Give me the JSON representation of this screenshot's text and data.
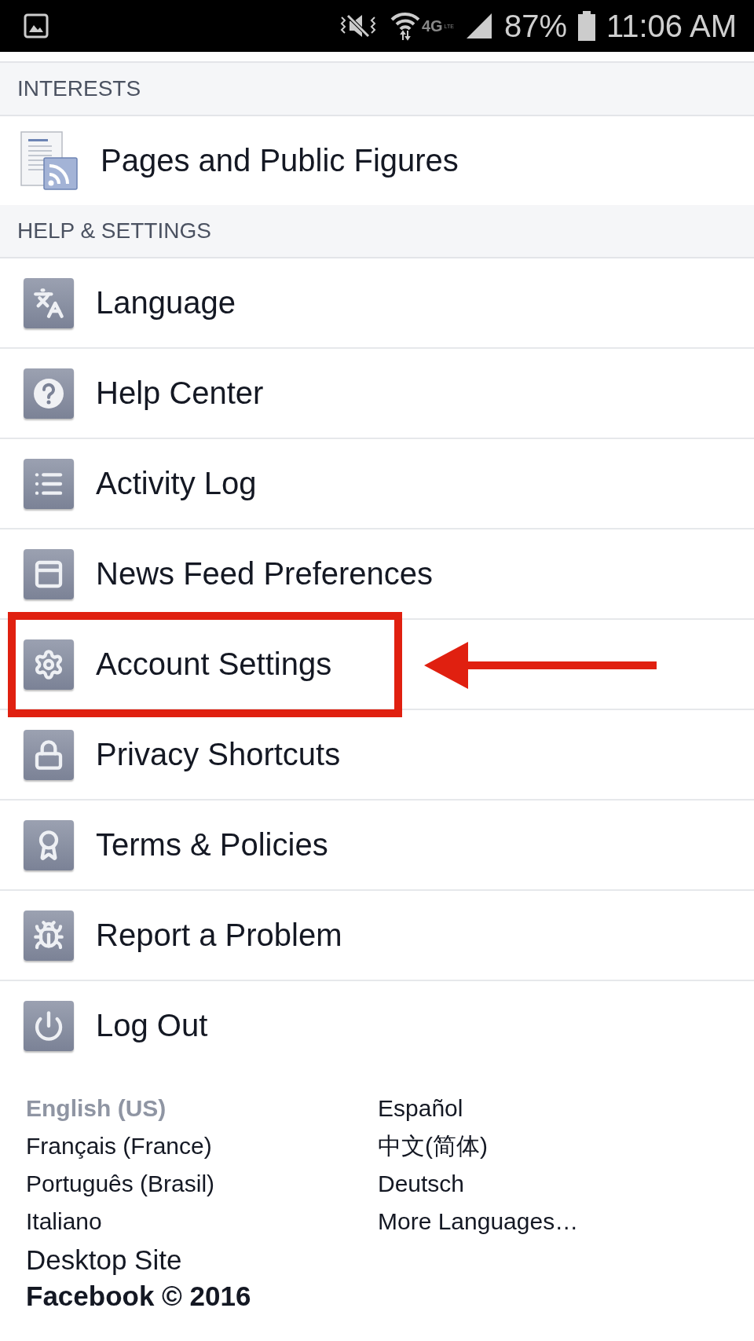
{
  "status_bar": {
    "network": "4G",
    "network_sub": "LTE",
    "battery": "87%",
    "time": "11:06 AM"
  },
  "sections": [
    {
      "header": "INTERESTS",
      "items": [
        {
          "label": "Pages and Public Figures",
          "highlighted": false
        }
      ]
    },
    {
      "header": "HELP & SETTINGS",
      "items": [
        {
          "label": "Language",
          "highlighted": false
        },
        {
          "label": "Help Center",
          "highlighted": false
        },
        {
          "label": "Activity Log",
          "highlighted": false
        },
        {
          "label": "News Feed Preferences",
          "highlighted": false
        },
        {
          "label": "Account Settings",
          "highlighted": true
        },
        {
          "label": "Privacy Shortcuts",
          "highlighted": false
        },
        {
          "label": "Terms & Policies",
          "highlighted": false
        },
        {
          "label": "Report a Problem",
          "highlighted": false
        },
        {
          "label": "Log Out",
          "highlighted": false
        }
      ]
    }
  ],
  "footer": {
    "languages": [
      {
        "label": "English (US)",
        "selected": true
      },
      {
        "label": "Español",
        "selected": false
      },
      {
        "label": "Français (France)",
        "selected": false
      },
      {
        "label": "中文(简体)",
        "selected": false
      },
      {
        "label": "Português (Brasil)",
        "selected": false
      },
      {
        "label": "Deutsch",
        "selected": false
      },
      {
        "label": "Italiano",
        "selected": false
      },
      {
        "label": "More Languages…",
        "selected": false
      }
    ],
    "desktop_site": "Desktop Site",
    "copyright": "Facebook © 2016"
  }
}
